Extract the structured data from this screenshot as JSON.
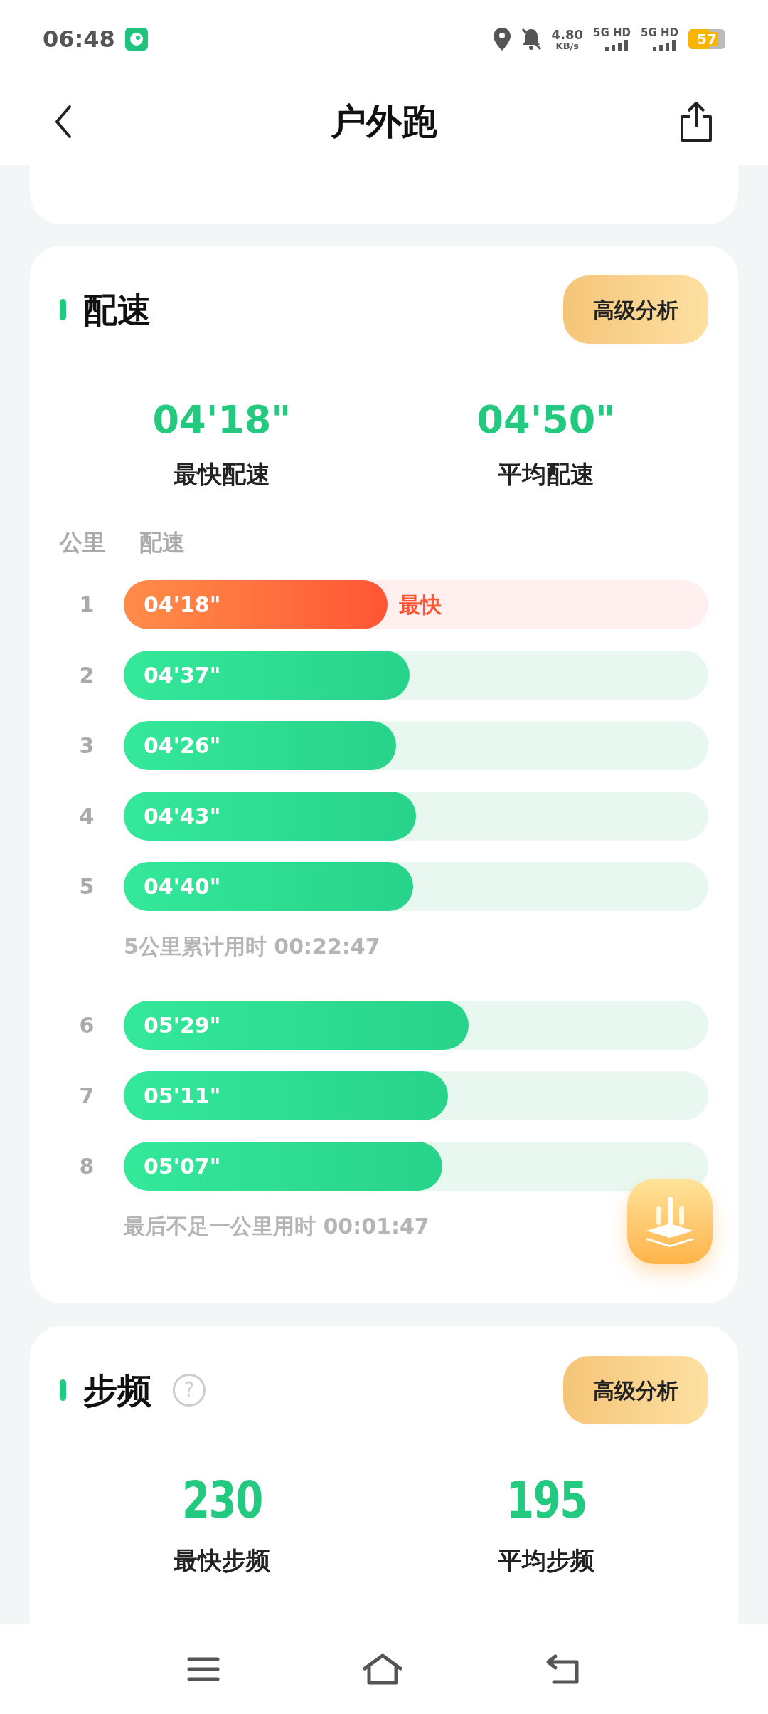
{
  "status_bar": {
    "time": "06:48",
    "speed_value": "4.80",
    "speed_unit": "KB/s",
    "networks": [
      "5G HD",
      "5G HD"
    ],
    "battery": "57"
  },
  "header": {
    "title": "户外跑"
  },
  "pace": {
    "title": "配速",
    "button": "高级分析",
    "stats": [
      {
        "value": "04'18\"",
        "label": "最快配速"
      },
      {
        "value": "04'50\"",
        "label": "平均配速"
      }
    ],
    "columns": [
      "公里",
      "配速"
    ],
    "items": [
      {
        "kind": "split",
        "km": "1",
        "pace": "04'18\"",
        "level": 0.451,
        "fastest": true,
        "tag": "最快"
      },
      {
        "kind": "split",
        "km": "2",
        "pace": "04'37\"",
        "level": 0.489,
        "fastest": false
      },
      {
        "kind": "split",
        "km": "3",
        "pace": "04'26\"",
        "level": 0.466,
        "fastest": false
      },
      {
        "kind": "split",
        "km": "4",
        "pace": "04'43\"",
        "level": 0.5,
        "fastest": false
      },
      {
        "kind": "split",
        "km": "5",
        "pace": "04'40\"",
        "level": 0.495,
        "fastest": false
      },
      {
        "kind": "note",
        "text": "5公里累计用时 00:22:47"
      },
      {
        "kind": "split",
        "km": "6",
        "pace": "05'29\"",
        "level": 0.59,
        "fastest": false
      },
      {
        "kind": "split",
        "km": "7",
        "pace": "05'11\"",
        "level": 0.555,
        "fastest": false
      },
      {
        "kind": "split",
        "km": "8",
        "pace": "05'07\"",
        "level": 0.545,
        "fastest": false
      },
      {
        "kind": "note",
        "text": "最后不足一公里用时 00:01:47"
      }
    ]
  },
  "cadence": {
    "title": "步频",
    "help": "?",
    "button": "高级分析",
    "stats": [
      {
        "value": "230",
        "label": "最快步频"
      },
      {
        "value": "195",
        "label": "平均步频"
      }
    ]
  }
}
